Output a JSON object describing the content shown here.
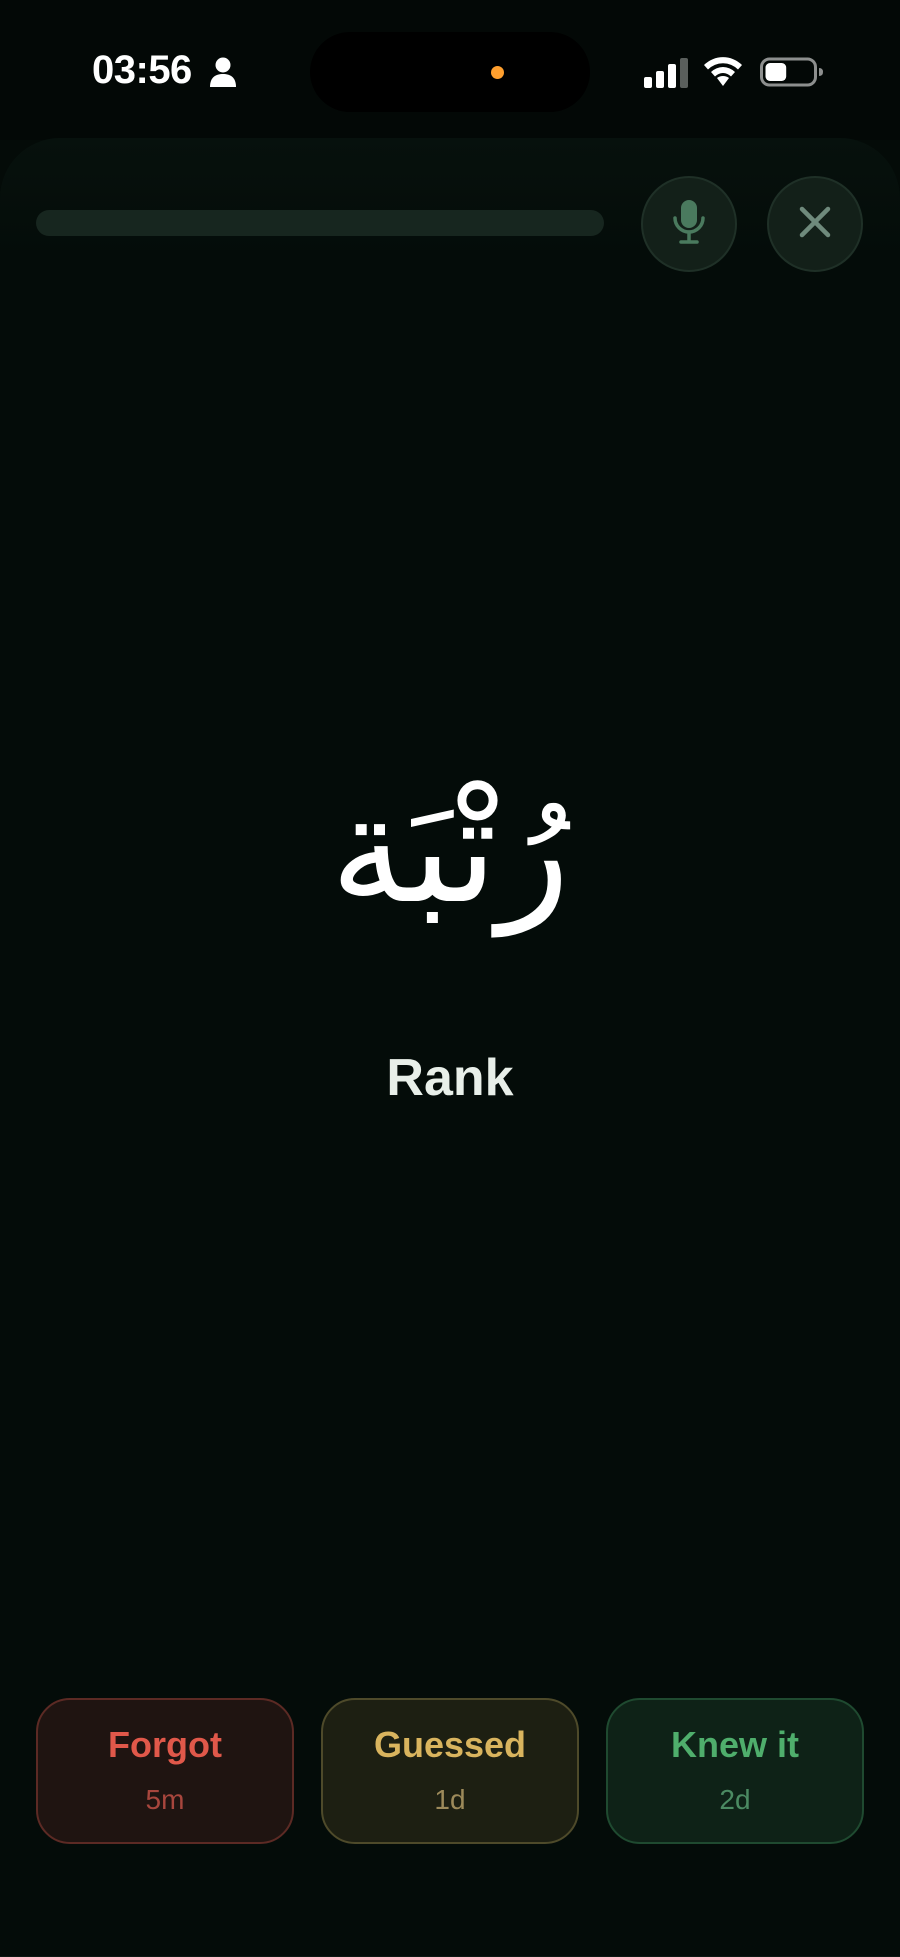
{
  "status_bar": {
    "time": "03:56",
    "person_icon": "person-icon",
    "recording_dot_color": "#ff9f2e",
    "signal_icon": "cellular-signal-icon",
    "wifi_icon": "wifi-icon",
    "battery_icon": "battery-icon",
    "battery_level": 0.45
  },
  "header": {
    "progress": 0.0,
    "mic_icon": "microphone-icon",
    "close_icon": "close-icon"
  },
  "card": {
    "arabic_word": "رُتْبَة",
    "translation": "Rank"
  },
  "ratings": [
    {
      "label": "Forgot",
      "interval": "5m",
      "color": "#e0584a",
      "sub_color": "#a8463d"
    },
    {
      "label": "Guessed",
      "interval": "1d",
      "color": "#d9b45e",
      "sub_color": "#9d8a5a"
    },
    {
      "label": "Knew it",
      "interval": "2d",
      "color": "#4fae6c",
      "sub_color": "#4b8a62"
    }
  ],
  "colors": {
    "background": "#040b08",
    "accent": "#4a7a5e"
  }
}
